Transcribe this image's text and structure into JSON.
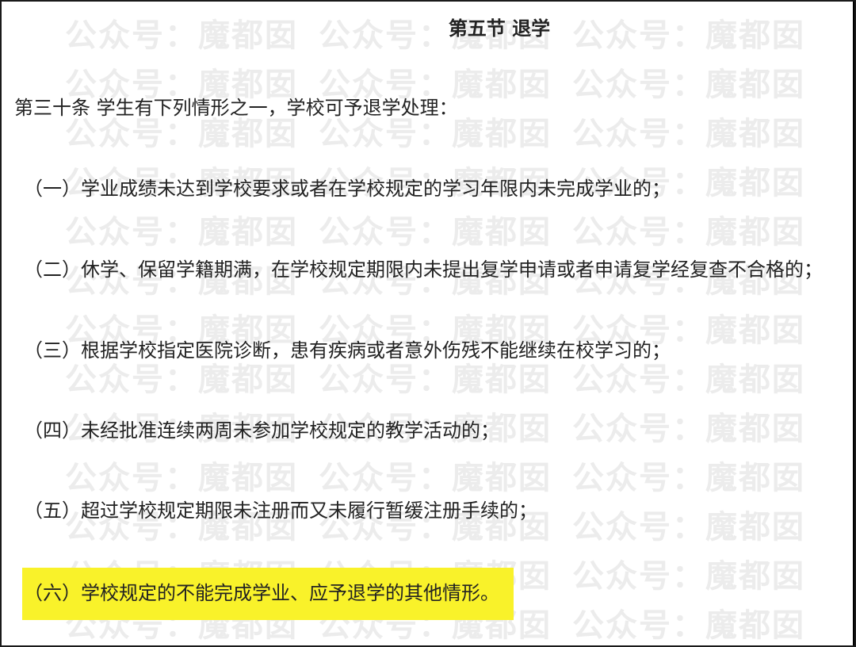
{
  "watermark": {
    "text": "公众号：魔都囡"
  },
  "section_title": "第五节 退学",
  "article_intro": "第三十条 学生有下列情形之一，学校可予退学处理：",
  "items": [
    "（一）学业成绩未达到学校要求或者在学校规定的学习年限内未完成学业的；",
    "（二）休学、保留学籍期满，在学校规定期限内未提出复学申请或者申请复学经复查不合格的；",
    "（三）根据学校指定医院诊断，患有疾病或者意外伤残不能继续在校学习的；",
    "（四）未经批准连续两周未参加学校规定的教学活动的；",
    "（五）超过学校规定期限未注册而又未履行暂缓注册手续的；",
    "（六）学校规定的不能完成学业、应予退学的其他情形。"
  ],
  "colors": {
    "highlight": "#f9f22a",
    "text": "#222222",
    "watermark": "#ececec"
  }
}
